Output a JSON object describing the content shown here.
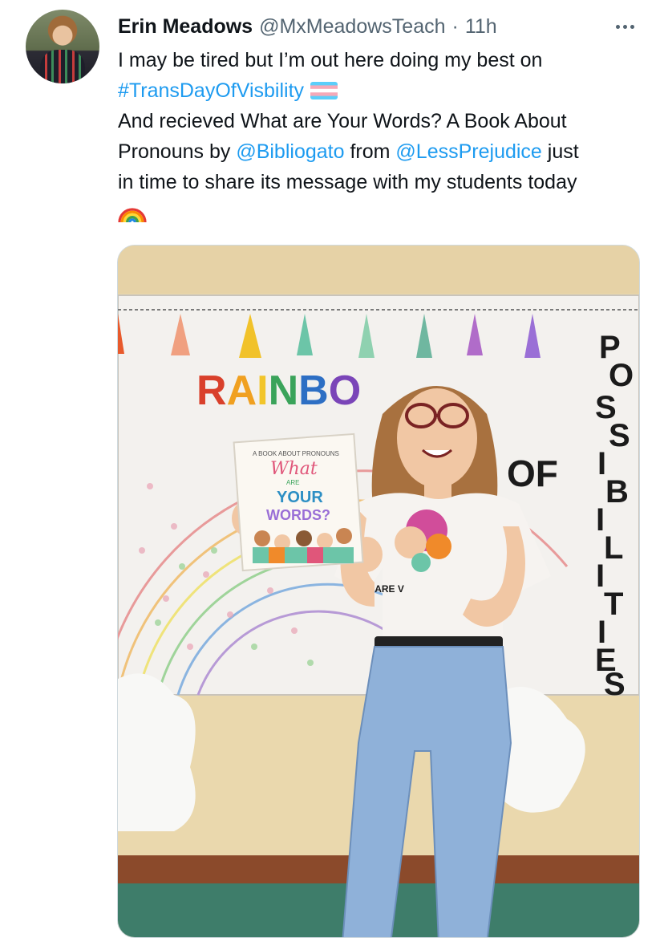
{
  "tweet": {
    "author_name": "Erin Meadows",
    "handle": "@MxMeadowsTeach",
    "separator": "·",
    "time": "11h",
    "more_icon": "more-horizontal-icon",
    "text": {
      "line1": "I may be tired but I’m out here doing my best on",
      "hashtag": "#TransDayOfVisbility",
      "flag_icon": "transgender-flag-emoji",
      "line3": "And recieved What are Your Words? A Book About",
      "line4_a": "Pronouns by ",
      "mention1": "@Bibliogato",
      "line4_b": " from ",
      "mention2": "@LessPrejudice",
      "line4_c": " just",
      "line5": "in time to share its message with my students today",
      "rainbow_icon": "rainbow-emoji"
    },
    "photo": {
      "description_icon": "photo",
      "board_word1": "RAINBO",
      "board_word2": "OF",
      "board_word3_letters": [
        "P",
        "O",
        "S",
        "S",
        "I",
        "B",
        "I",
        "L",
        "I",
        "T",
        "I",
        "E",
        "S"
      ],
      "book": {
        "top_line": "A BOOK ABOUT PRONOUNS",
        "title_what": "What",
        "title_are": "ARE",
        "title_your": "YOUR",
        "title_words": "WORDS?"
      },
      "shirt_text": "WE ARE V"
    }
  },
  "colors": {
    "link": "#1d9bf0",
    "secondary": "#536471",
    "text": "#0f1419"
  }
}
